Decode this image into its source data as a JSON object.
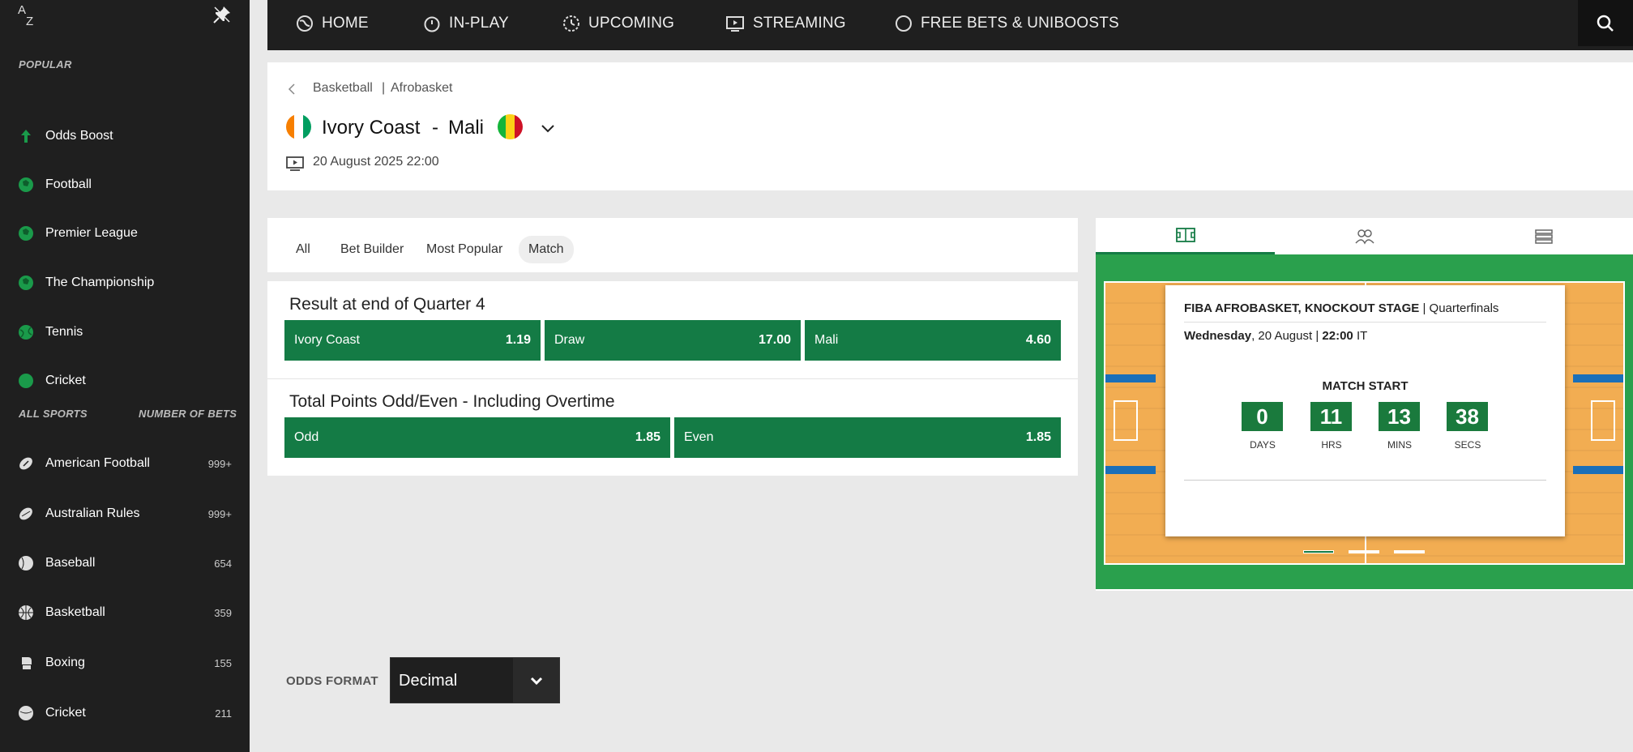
{
  "sidebar": {
    "az_icon_a": "A",
    "az_icon_z": "Z",
    "popular_heading": "POPULAR",
    "popular_items": [
      {
        "label": "Odds Boost",
        "icon": "odds-boost-icon"
      },
      {
        "label": "Football",
        "icon": "football-icon"
      },
      {
        "label": "Premier League",
        "icon": "football-icon"
      },
      {
        "label": "The Championship",
        "icon": "football-icon"
      },
      {
        "label": "Tennis",
        "icon": "tennis-icon"
      },
      {
        "label": "Cricket",
        "icon": "cricket-icon"
      }
    ],
    "all_sports_heading": "ALL SPORTS",
    "number_of_bets_heading": "NUMBER OF BETS",
    "sports": [
      {
        "label": "American Football",
        "count": "999+",
        "icon": "american-football-icon"
      },
      {
        "label": "Australian Rules",
        "count": "999+",
        "icon": "australian-rules-icon"
      },
      {
        "label": "Baseball",
        "count": "654",
        "icon": "baseball-icon"
      },
      {
        "label": "Basketball",
        "count": "359",
        "icon": "basketball-icon"
      },
      {
        "label": "Boxing",
        "count": "155",
        "icon": "boxing-glove-icon"
      },
      {
        "label": "Cricket",
        "count": "211",
        "icon": "cricket-icon"
      }
    ]
  },
  "topnav": {
    "items": [
      {
        "label": "HOME",
        "icon": "home-globe-icon"
      },
      {
        "label": "IN-PLAY",
        "icon": "stopwatch-icon"
      },
      {
        "label": "UPCOMING",
        "icon": "upcoming-clock-icon"
      },
      {
        "label": "STREAMING",
        "icon": "streaming-tv-icon"
      },
      {
        "label": "FREE BETS & UNIBOOSTS",
        "icon": "circle-icon"
      }
    ],
    "search_icon": "search-icon"
  },
  "event": {
    "breadcrumb_sport": "Basketball",
    "breadcrumb_separator": "|",
    "breadcrumb_league": "Afrobasket",
    "home_team": "Ivory Coast",
    "separator": "-",
    "away_team": "Mali",
    "datetime": "20 August 2025 22:00",
    "home_flag_colors": [
      "#f77f00",
      "#ffffff",
      "#009e60"
    ],
    "away_flag_colors": [
      "#14b53a",
      "#fcd116",
      "#ce1126"
    ]
  },
  "market_tabs": {
    "items": [
      "All",
      "Bet Builder",
      "Most Popular",
      "Match"
    ],
    "active": "Match"
  },
  "markets": [
    {
      "title": "Result at end of Quarter 4",
      "outcomes": [
        {
          "label": "Ivory Coast",
          "odds": "1.19"
        },
        {
          "label": "Draw",
          "odds": "17.00"
        },
        {
          "label": "Mali",
          "odds": "4.60"
        }
      ]
    },
    {
      "title": "Total Points Odd/Even - Including Overtime",
      "outcomes": [
        {
          "label": "Odd",
          "odds": "1.85"
        },
        {
          "label": "Even",
          "odds": "1.85"
        }
      ]
    }
  ],
  "match_panel": {
    "tabs": [
      "court-icon",
      "players-icon",
      "stats-list-icon"
    ],
    "competition_bold": "FIBA AFROBASKET, KNOCKOUT STAGE",
    "competition_sep": "|",
    "competition_round": "Quarterfinals",
    "day_bold": "Wednesday",
    "date_text": ", 20 August |",
    "time_bold": "22:00",
    "time_zone": "IT",
    "match_start_label": "MATCH START",
    "countdown": [
      {
        "value": "0",
        "label": "DAYS"
      },
      {
        "value": "11",
        "label": "HRS"
      },
      {
        "value": "13",
        "label": "MINS"
      },
      {
        "value": "38",
        "label": "SECS"
      }
    ],
    "colors": {
      "court_green": "#2aa04d",
      "floor": "#f2ad52",
      "accent": "#147b45",
      "lane_blue": "#1b6fb8"
    }
  },
  "odds_format": {
    "label": "ODDS FORMAT",
    "value": "Decimal"
  }
}
